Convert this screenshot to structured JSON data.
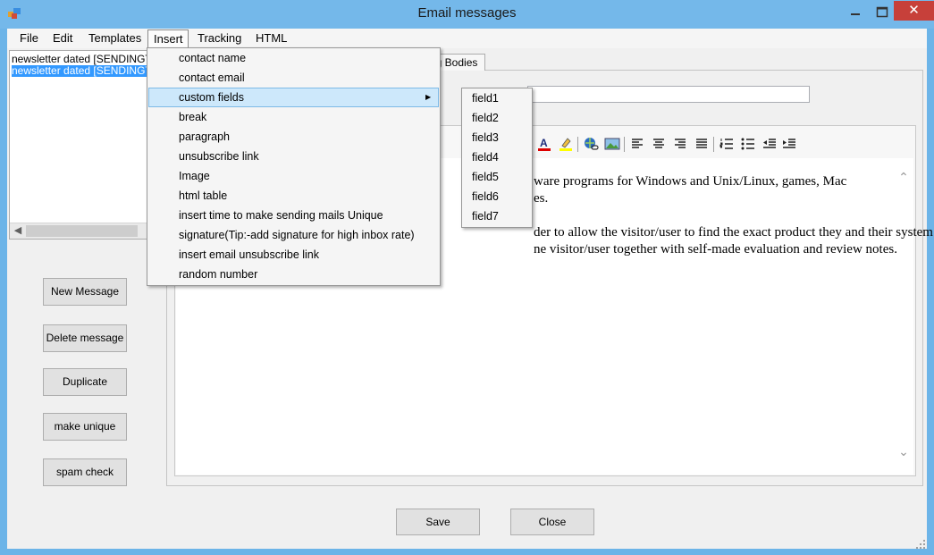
{
  "window": {
    "title": "Email messages",
    "close_glyph": "✕"
  },
  "menubar": {
    "items": [
      {
        "label": "File"
      },
      {
        "label": "Edit"
      },
      {
        "label": "Templates"
      },
      {
        "label": "Insert"
      },
      {
        "label": "Tracking"
      },
      {
        "label": "HTML"
      }
    ],
    "open_menu": "Insert"
  },
  "message_list": {
    "items": [
      {
        "label": "newsletter dated [SENDINGTIME]",
        "selected": false
      },
      {
        "label": "newsletter dated [SENDINGTIME]",
        "selected": true
      }
    ]
  },
  "buttons": {
    "new_message": "New Message",
    "delete_message": "Delete message",
    "duplicate": "Duplicate",
    "make_unique": "make unique",
    "spam_check": "spam check",
    "save": "Save",
    "close": "Close"
  },
  "tabs": {
    "bodies": "ng Bodies"
  },
  "subject": {
    "value": ""
  },
  "editor": {
    "line1": "ware programs for Windows and Unix/Linux, games, Mac",
    "line2": "es.",
    "line3": "der to allow the visitor/user to find the exact product they and their system needs.",
    "line4": "ne visitor/user together with self-made evaluation and review notes."
  },
  "toolbar_icons": [
    "font-color-icon",
    "highlight-color-icon",
    "insert-link-icon",
    "insert-image-icon",
    "align-left-icon",
    "align-center-icon",
    "align-right-icon",
    "justify-icon",
    "numbered-list-icon",
    "bullet-list-icon",
    "outdent-icon",
    "indent-icon"
  ],
  "insert_menu": {
    "items": [
      {
        "label": "contact name"
      },
      {
        "label": "contact email"
      },
      {
        "label": "custom fields",
        "has_submenu": true,
        "highlighted": true
      },
      {
        "label": "break"
      },
      {
        "label": "paragraph"
      },
      {
        "label": "unsubscribe link"
      },
      {
        "label": "Image"
      },
      {
        "label": "html table"
      },
      {
        "label": "insert time to make sending mails Unique"
      },
      {
        "label": "signature(Tip:-add signature for high inbox rate)"
      },
      {
        "label": "insert email unsubscribe link"
      },
      {
        "label": "random number"
      }
    ]
  },
  "custom_fields_menu": {
    "items": [
      {
        "label": "field1"
      },
      {
        "label": "field2"
      },
      {
        "label": "field3"
      },
      {
        "label": "field4"
      },
      {
        "label": "field5"
      },
      {
        "label": "field6"
      },
      {
        "label": "field7"
      }
    ]
  },
  "colors": {
    "titlebar": "#74b8ea",
    "close_button": "#c7403a",
    "selection": "#3399ff",
    "menu_highlight": "#cde8fb"
  }
}
